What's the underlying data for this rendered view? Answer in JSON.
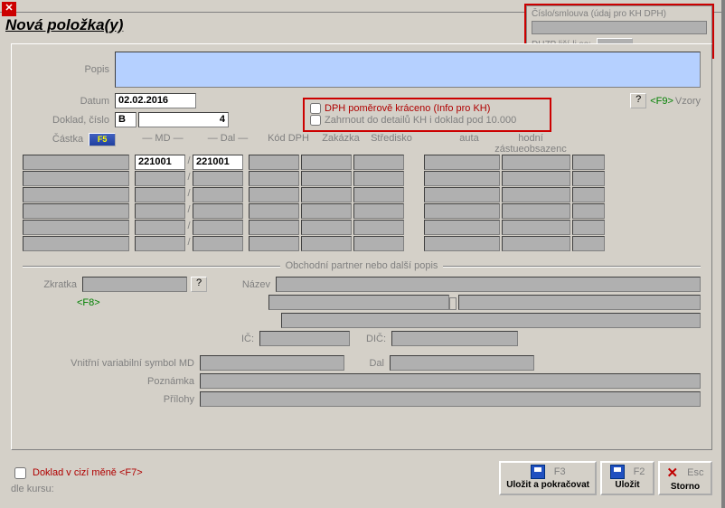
{
  "title": "Nová položka(y)",
  "topRight": {
    "label1": "Číslo/smlouva (údaj pro KH DPH)",
    "label2": "DUZP liší-li se:",
    "btn": ". ."
  },
  "labels": {
    "popis": "Popis",
    "datum": "Datum",
    "doklad": "Doklad, číslo",
    "vzoryKey": "<F9>",
    "vzory": "Vzory",
    "castka": "Částka",
    "md": "— MD —",
    "dal": "— Dal —",
    "kod": "Kód DPH",
    "zakazka": "Zakázka",
    "stredisko": "Středisko",
    "auta": "auta",
    "hodni": "hodní zástueobsazenc",
    "f5": "F5",
    "partnerTitle": "Obchodní partner nebo další popis",
    "zkratka": "Zkratka",
    "f8": "<F8>",
    "nazev": "Název",
    "ic": "IČ:",
    "dic": "DIČ:",
    "vvs": "Vnitřní variabilní symbol  MD",
    "dalLbl": "Dal",
    "poznamka": "Poznámka",
    "prilohy": "Přílohy"
  },
  "options": {
    "dphPomer": "DPH poměrově kráceno (Info pro KH)",
    "zahrnout": "Zahrnout do detailů KH i doklad pod 10.000"
  },
  "values": {
    "datum": "02.02.2016",
    "dokladSerie": "B",
    "dokladCislo": "4",
    "md": "221001",
    "dal": "221001"
  },
  "footer": {
    "cizi": "Doklad v cizí měně <F7>",
    "kurs": "dle kursu:",
    "btn1": "Uložit a pokračovat",
    "btn1Key": "F3",
    "btn2": "Uložit",
    "btn2Key": "F2",
    "btn3": "Storno",
    "btn3Key": "Esc"
  }
}
